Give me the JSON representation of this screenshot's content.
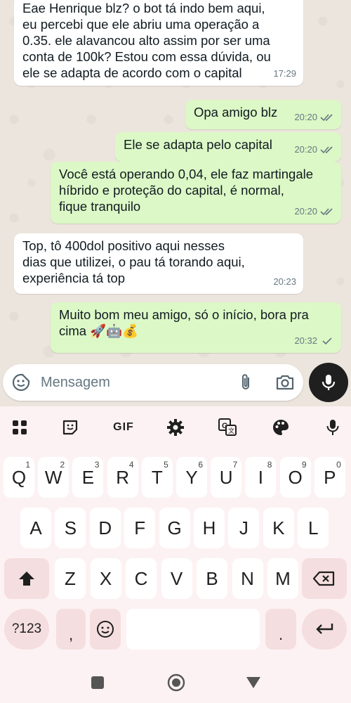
{
  "messages": [
    {
      "dir": "in",
      "text": "Eae Henrique blz? o bot tá indo bem aqui,\neu percebi que ele abriu uma operação a\n0.35. ele alavancou alto assim por ser uma\nconta de 100k? Estou com essa dúvida, ou\nele se adapta de acordo com o capital",
      "time": "17:29"
    },
    {
      "dir": "out",
      "text": "Opa amigo blz",
      "time": "20:20",
      "status": "read"
    },
    {
      "dir": "out",
      "text": "Ele se adapta pelo capital",
      "time": "20:20",
      "status": "read"
    },
    {
      "dir": "out",
      "text": "Você está operando 0,04, ele faz martingale\nhíbrido e proteção do capital, é normal,\nfique tranquilo",
      "time": "20:20",
      "status": "read"
    },
    {
      "dir": "in",
      "text": "Top, tô 400dol positivo aqui nesses\ndias que utilizei, o pau tá torando aqui,\nexperiência tá top",
      "time": "20:23"
    },
    {
      "dir": "out",
      "text": "Muito bom meu amigo, só o início, bora pra\ncima 🚀🤖💰",
      "time": "20:32",
      "status": "sent"
    }
  ],
  "compose": {
    "placeholder": "Mensagem",
    "value": ""
  },
  "keyboard": {
    "toolbar": {
      "gif_label": "GIF"
    },
    "row1": [
      {
        "k": "Q",
        "h": "1"
      },
      {
        "k": "W",
        "h": "2"
      },
      {
        "k": "E",
        "h": "3"
      },
      {
        "k": "R",
        "h": "4"
      },
      {
        "k": "T",
        "h": "5"
      },
      {
        "k": "Y",
        "h": "6"
      },
      {
        "k": "U",
        "h": "7"
      },
      {
        "k": "I",
        "h": "8"
      },
      {
        "k": "O",
        "h": "9"
      },
      {
        "k": "P",
        "h": "0"
      }
    ],
    "row2": [
      "A",
      "S",
      "D",
      "F",
      "G",
      "H",
      "J",
      "K",
      "L"
    ],
    "row3": [
      "Z",
      "X",
      "C",
      "V",
      "B",
      "N",
      "M"
    ],
    "symbols_label": "?123",
    "comma_label": ",",
    "period_label": "."
  },
  "icons": {
    "emoji": "sticker-smile-icon",
    "attach": "paperclip-icon",
    "camera": "camera-icon",
    "mic": "mic-icon",
    "apps": "apps-grid-icon",
    "sticker": "sticker-icon",
    "settings": "gear-icon",
    "translate": "translate-icon",
    "theme": "palette-icon",
    "voice": "mic-icon",
    "shift": "shift-icon",
    "backspace": "backspace-icon",
    "enter": "enter-icon",
    "back": "nav-back-icon",
    "home": "nav-home-icon",
    "recents": "nav-recents-icon"
  },
  "colors": {
    "out_bubble": "#dcf8c6",
    "in_bubble": "#ffffff",
    "mic_button": "#1f1f1f",
    "keyboard_bg": "#fdf2f3",
    "read_tick": "#667781"
  }
}
